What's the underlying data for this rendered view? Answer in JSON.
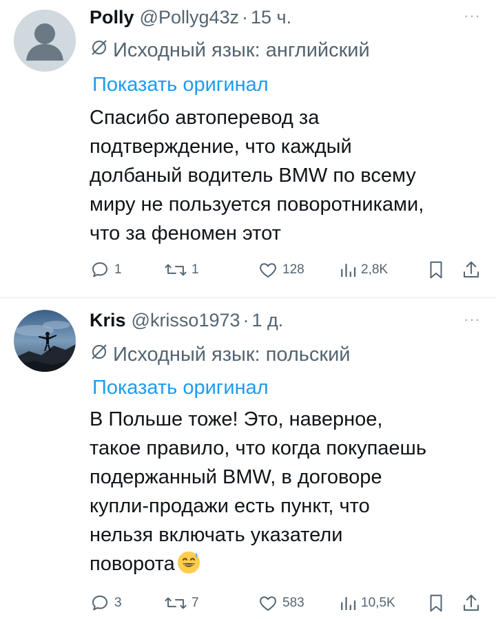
{
  "tweets": [
    {
      "name": "Polly",
      "handle": "@Pollyg43z",
      "dot": "·",
      "time": "15 ч.",
      "more": "···",
      "lang_label": "Исходный язык: английский",
      "show_original": "Показать оригинал",
      "text": "Спасибо автоперевод за\nподтверждение, что каждый\nдолбаный водитель BMW по всему\nмиру не пользуется поворотниками,\nчто за феномен этот",
      "replies": "1",
      "retweets": "1",
      "likes": "128",
      "views": "2,8K",
      "avatar": "default-avatar-icon"
    },
    {
      "name": "Kris",
      "handle": "@krisso1973",
      "dot": "·",
      "time": "1 д.",
      "more": "···",
      "lang_label": "Исходный язык: польский",
      "show_original": "Показать оригинал",
      "text": "В Польше тоже! Это, наверное,\nтакое правило, что когда покупаешь\nподержанный BMW, в договоре\nкупли-продажи есть пункт, что\nнельзя включать указатели\nповорота",
      "emoji": "grinning-face-with-sweat",
      "replies": "3",
      "retweets": "7",
      "likes": "583",
      "views": "10,5K",
      "avatar": "silhouette-photo-avatar"
    }
  ],
  "colors": {
    "link": "#1d9bf0",
    "secondary": "#536471",
    "text": "#0f1419",
    "divider": "#e6e9ec"
  }
}
